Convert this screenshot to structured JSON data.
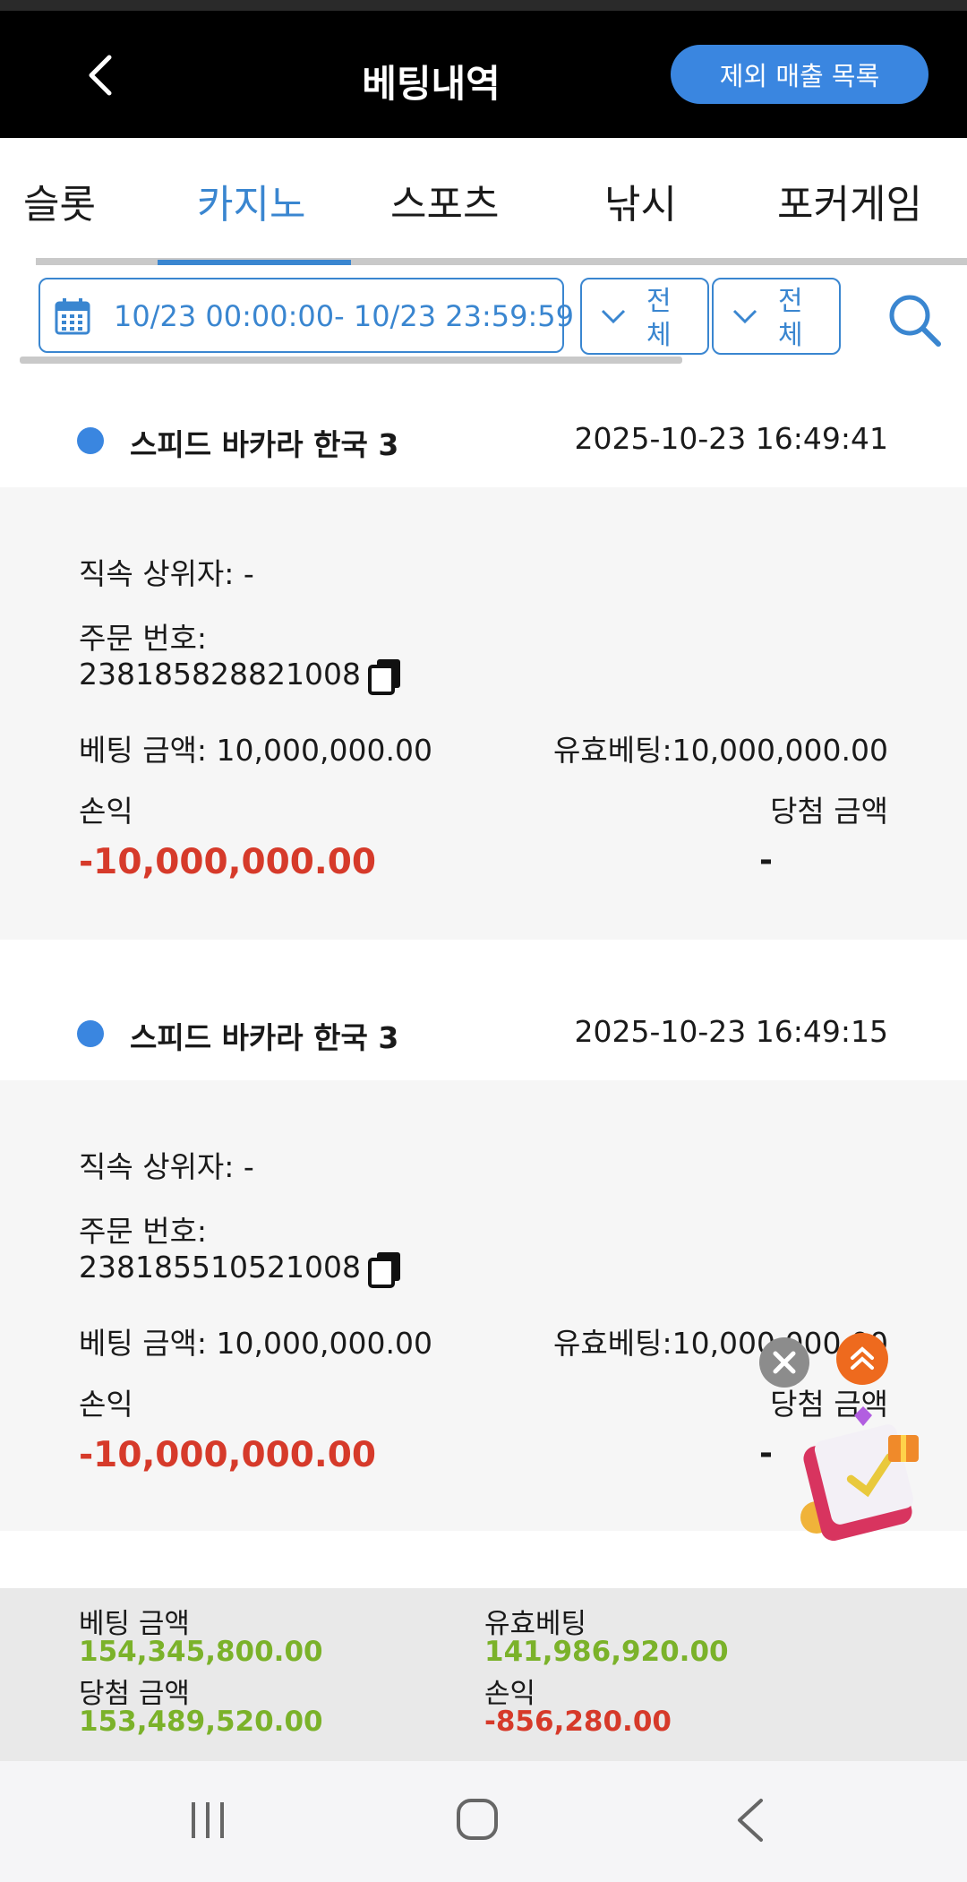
{
  "header": {
    "title": "베팅내역",
    "exclude_button": "제외 매출 목록"
  },
  "tabs": [
    {
      "label": "슬롯",
      "active": false
    },
    {
      "label": "카지노",
      "active": true
    },
    {
      "label": "스포츠",
      "active": false
    },
    {
      "label": "낚시",
      "active": false
    },
    {
      "label": "포커게임",
      "active": false
    }
  ],
  "filters": {
    "date_range": "10/23 00:00:00- 10/23 23:59:59",
    "select1": "전체",
    "select2": "전체"
  },
  "records": [
    {
      "game": "스피드 바카라 한국 3",
      "time": "2025-10-23 16:49:41",
      "parent": "직속 상위자: -",
      "order_label": "주문 번호:",
      "order_no": "238185828821008",
      "bet_amount": "베팅 금액: 10,000,000.00",
      "valid_bet": "유효베팅:10,000,000.00",
      "profit_label": "손익",
      "win_label": "당첨 금액",
      "profit": "-10,000,000.00",
      "win": "-"
    },
    {
      "game": "스피드 바카라 한국 3",
      "time": "2025-10-23 16:49:15",
      "parent": "직속 상위자: -",
      "order_label": "주문 번호:",
      "order_no": "238185510521008",
      "bet_amount": "베팅 금액: 10,000,000.00",
      "valid_bet": "유효베팅:10,000,000.00",
      "profit_label": "손익",
      "win_label": "당첨 금액",
      "profit": "-10,000,000.00",
      "win": "-"
    }
  ],
  "summary": {
    "bet_label": "베팅 금액",
    "bet_value": "154,345,800.00",
    "valid_label": "유효베팅",
    "valid_value": "141,986,920.00",
    "win_label": "당첨 금액",
    "win_value": "153,489,520.00",
    "profit_label": "손익",
    "profit_value": "-856,280.00"
  },
  "colors": {
    "accent": "#3a86d0",
    "loss": "#d63a2a",
    "gain": "#7bb22a"
  }
}
